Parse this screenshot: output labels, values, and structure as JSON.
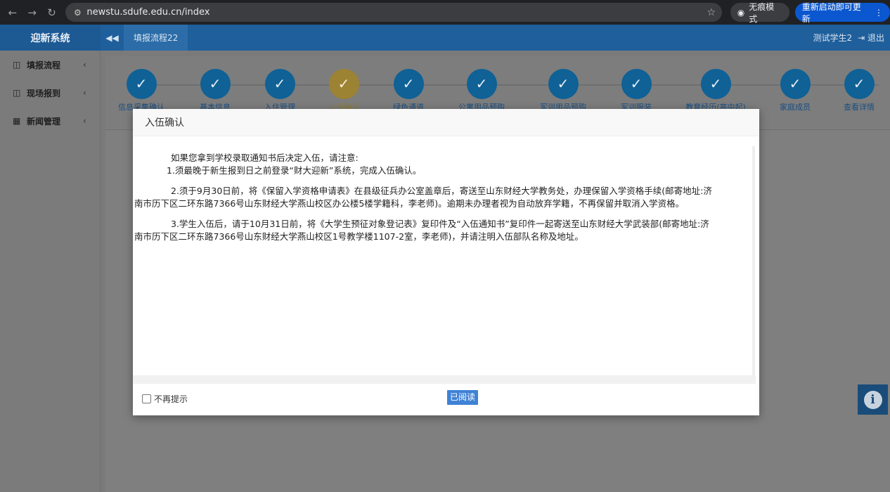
{
  "browser": {
    "url": "newstu.sdufe.edu.cn/index",
    "incognito_label": "无痕模式",
    "restart_label": "重新启动即可更新"
  },
  "header": {
    "brand": "迎新系统",
    "tab_label": "填报流程22",
    "user_name": "测试学生2",
    "logout_label": "退出"
  },
  "sidebar": {
    "items": [
      {
        "label": "填报流程"
      },
      {
        "label": "现场报到"
      },
      {
        "label": "新闻管理"
      }
    ]
  },
  "steps": [
    {
      "label": "信息采集确认",
      "state": "done"
    },
    {
      "label": "基本信息",
      "state": "done"
    },
    {
      "label": "入住管理",
      "state": "done"
    },
    {
      "label": "入伍确认",
      "state": "active"
    },
    {
      "label": "绿色通道",
      "state": "done"
    },
    {
      "label": "公寓用品预购",
      "state": "done"
    },
    {
      "label": "军训用品预购",
      "state": "done"
    },
    {
      "label": "军训服装",
      "state": "done"
    },
    {
      "label": "教育经历(高中起)",
      "state": "done"
    },
    {
      "label": "家庭成员",
      "state": "done"
    },
    {
      "label": "查看详情",
      "state": "done"
    }
  ],
  "modal": {
    "title": "入伍确认",
    "lines": {
      "l1": "如果您拿到学校录取通知书后决定入伍，请注意:",
      "l2": "1.须最晚于新生报到日之前登录“财大迎新”系统，完成入伍确认。",
      "p2a": "2.须于9月30日前，将《保留入学资格申请表》在县级征兵办公室盖章后，寄送至山东财经大学教务处，办理保留入学资格手续(邮寄地址:济",
      "p2b": "南市历下区二环东路7366号山东财经大学燕山校区办公楼5楼学籍科，李老师)。逾期未办理者视为自动放弃学籍，不再保留并取消入学资格。",
      "p3a": "3.学生入伍后，请于10月31日前，将《大学生预征对象登记表》复印件及“入伍通知书”复印件一起寄送至山东财经大学武装部(邮寄地址:济",
      "p3b": "南市历下区二环东路7366号山东财经大学燕山校区1号教学楼1107-2室，李老师)，并请注明入伍部队名称及地址。"
    },
    "dont_remind_label": "不再提示",
    "read_button_label": "已阅读"
  }
}
